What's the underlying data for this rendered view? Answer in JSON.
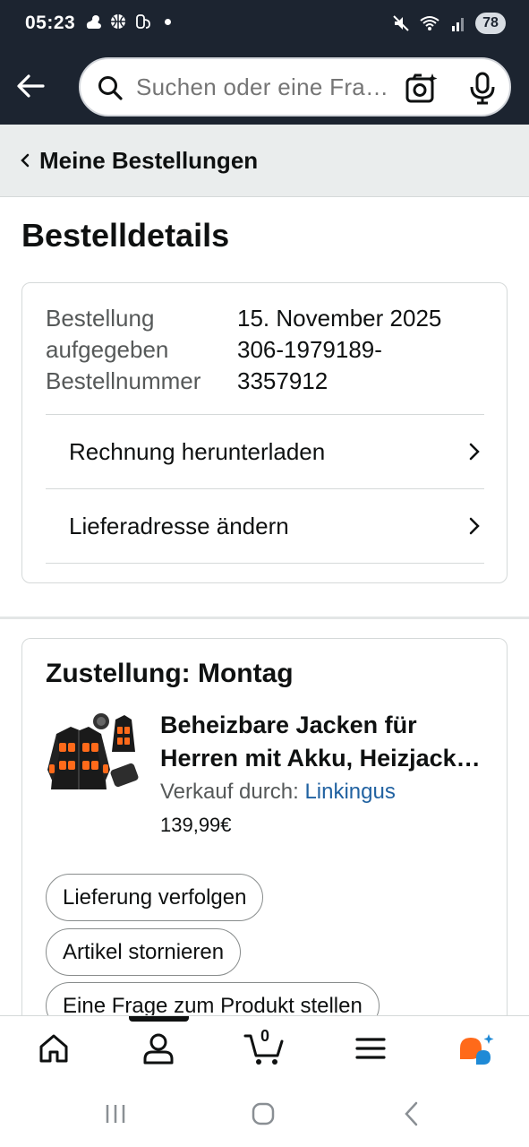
{
  "status_bar": {
    "time": "05:23",
    "battery": "78"
  },
  "search": {
    "placeholder": "Suchen oder eine Frage stellen"
  },
  "breadcrumb": {
    "label": "Meine Bestellungen"
  },
  "page": {
    "title": "Bestelldetails"
  },
  "order": {
    "placed_label_1": "Bestellung",
    "placed_label_2": "aufgegeben",
    "placed_value": "15. November 2025",
    "number_label": "Bestellnummer",
    "number_value_1": "306-1979189-",
    "number_value_2": "3357912"
  },
  "links": [
    {
      "label": "Rechnung herunterladen"
    },
    {
      "label": "Lieferadresse ändern"
    }
  ],
  "delivery": {
    "title": "Zustellung: Montag",
    "product_title_1": "Beheizbare Jacken für",
    "product_title_2": "Herren mit Akku, Heizjacke Herren",
    "seller_prefix": "Verkauf durch: ",
    "seller_name": "Linkingus",
    "price": "139,99€"
  },
  "actions": [
    {
      "label": "Lieferung verfolgen"
    },
    {
      "label": "Artikel stornieren"
    },
    {
      "label": "Eine Frage zum Produkt stellen"
    }
  ],
  "bottom_nav": {
    "cart_count": "0"
  },
  "colors": {
    "header_bg": "#1c2430",
    "link": "#2162a1",
    "breadcrumb_bg": "#eaeded"
  }
}
